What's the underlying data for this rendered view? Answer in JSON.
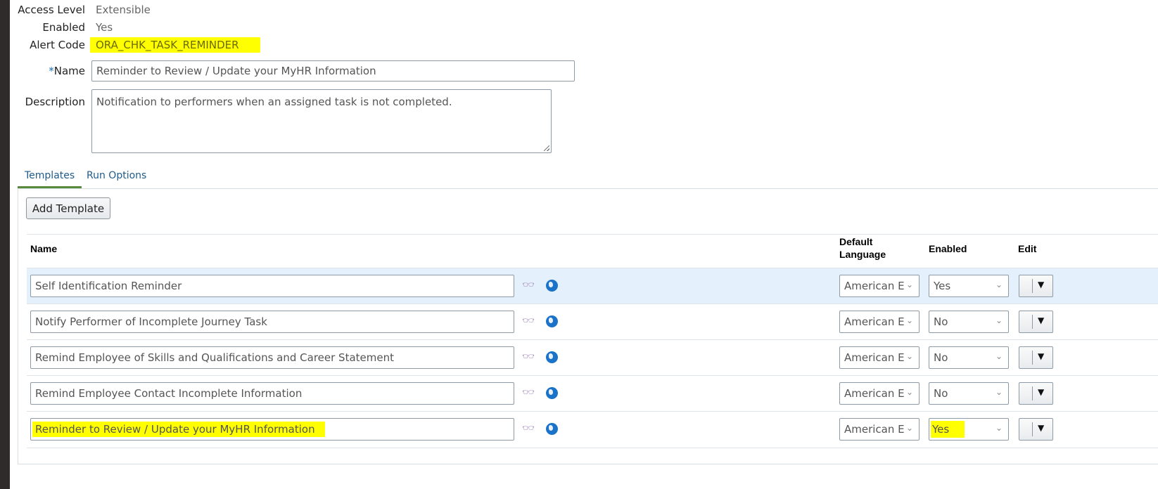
{
  "header": {
    "access_level_label": "Access Level",
    "access_level": "Extensible",
    "enabled_label": "Enabled",
    "enabled": "Yes",
    "alert_code_label": "Alert Code",
    "alert_code": "ORA_CHK_TASK_REMINDER",
    "name_required": "*",
    "name_label": "Name",
    "name_value": "Reminder to Review / Update your MyHR Information",
    "description_label": "Description",
    "description_value": "Notification to performers when an assigned task is not completed."
  },
  "tabs": [
    {
      "label": "Templates",
      "active": true
    },
    {
      "label": "Run Options",
      "active": false
    }
  ],
  "add_template_label": "Add Template",
  "table": {
    "columns": [
      "Name",
      "Default Language",
      "Enabled",
      "Edit"
    ],
    "default_language_line1": "Default",
    "default_language_line2": "Language",
    "rows": [
      {
        "name": "Self Identification Reminder",
        "language": "American E",
        "enabled": "Yes"
      },
      {
        "name": "Notify Performer of Incomplete Journey Task",
        "language": "American E",
        "enabled": "No"
      },
      {
        "name": "Remind Employee of Skills and Qualifications and Career Statement",
        "language": "American E",
        "enabled": "No"
      },
      {
        "name": "Remind Employee Contact Incomplete Information",
        "language": "American E",
        "enabled": "No"
      },
      {
        "name": "Reminder to Review / Update your MyHR Information",
        "language": "American E",
        "enabled": "Yes"
      }
    ]
  },
  "colors": {
    "highlight": "#ffff00",
    "selected_row": "#e4f0fb",
    "tab_accent": "#5a8a3c"
  }
}
